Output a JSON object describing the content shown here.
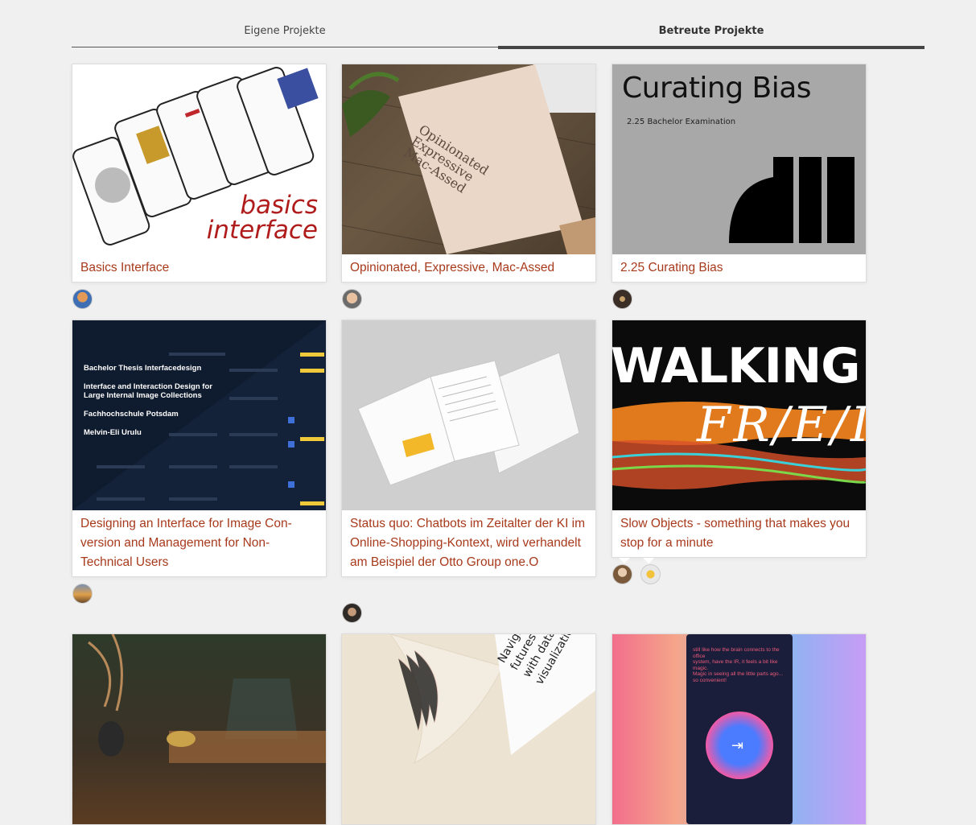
{
  "tabs": [
    {
      "label": "Eigene Projekte",
      "active": false
    },
    {
      "label": "Betreute Projekte",
      "active": true
    }
  ],
  "projects": [
    {
      "title": "Basics Interface",
      "thumb_text": [
        "basics",
        "interface"
      ],
      "avatars": [
        "avatar-blue"
      ]
    },
    {
      "title": "Opinionated, Expressive, Mac-Assed",
      "thumb_text": [
        "Opinionated",
        "Expressive",
        "Mac-Assed"
      ],
      "avatars": [
        "avatar-face"
      ]
    },
    {
      "title": "2.25 Curating Bias",
      "thumb_text": [
        "Curating Bias",
        "2.25 Bachelor Examination"
      ],
      "avatars": [
        "avatar-dark"
      ]
    },
    {
      "title": "Designing an Interface for Image Con-version and Management for Non-Technical Users",
      "thumb_text": [
        "Bachelor Thesis Interfacedesign",
        "Interface and Interaction Design for",
        "Large Internal Image Collections",
        "Fachhochschule Potsdam",
        "Melvin-Eli Urulu"
      ],
      "avatars": [
        "avatar-sunset"
      ]
    },
    {
      "title": "Status quo: Chatbots im Zeitalter der KI im Online-Shopping-Kontext, wird verhandelt am Beispiel der Otto Group one.O",
      "thumb_text": [],
      "avatars": [
        "avatar-portrait"
      ]
    },
    {
      "title": "Slow Objects - something that makes you stop for a minute",
      "thumb_text": [
        "WALKING",
        "FR/E/I"
      ],
      "avatars": [
        "avatar-brown",
        "avatar-yellow"
      ]
    },
    {
      "title": "",
      "thumb_text": [],
      "avatars": []
    },
    {
      "title": "",
      "thumb_text": [
        "Navigating futures",
        "with data visualization"
      ],
      "avatars": []
    },
    {
      "title": "",
      "thumb_text": [
        "still like how the brain connects to the office",
        "system, have the IR, it feels a bit like magic.",
        "Magic in seeing all the little parts ago...",
        "so convenient!"
      ],
      "avatars": []
    }
  ],
  "colors": {
    "title_accent": "#a83a1c",
    "page_bg": "#f0f0f0",
    "tab_active_border": "#444444"
  }
}
